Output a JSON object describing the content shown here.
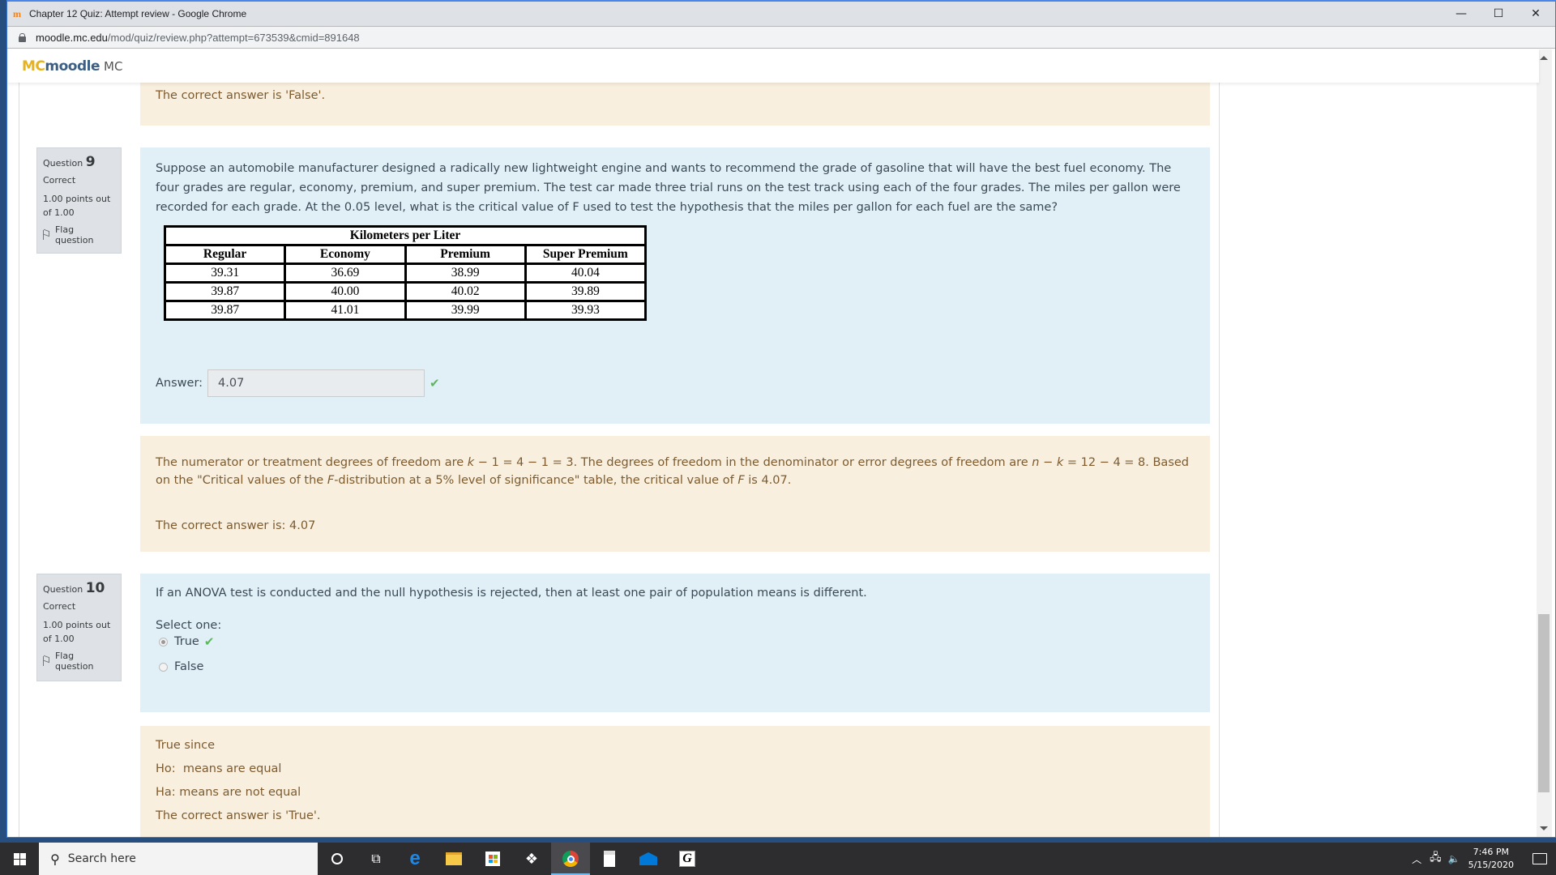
{
  "browser": {
    "window_title": "Chapter 12 Quiz: Attempt review - Google Chrome",
    "url_host": "moodle.mc.edu",
    "url_path": "/mod/quiz/review.php?attempt=673539&cmid=891648",
    "controls": {
      "minimize": "—",
      "maximize": "☐",
      "close": "✕"
    }
  },
  "site": {
    "logo_mc": "MC",
    "logo_moodle": "moodle",
    "site_name": "MC"
  },
  "prev_feedback": {
    "correct_answer": "The correct answer is 'False'."
  },
  "questions": [
    {
      "info": {
        "label": "Question",
        "number": "9",
        "state": "Correct",
        "grade": "1.00 points out of 1.00",
        "flag": "Flag question"
      },
      "text": "Suppose an automobile manufacturer designed a radically new lightweight engine and wants to recommend the grade of gasoline that will have the best fuel economy. The four grades are regular, economy, premium, and super premium. The test car made three trial runs on the test track using each of the four grades. The miles per gallon were recorded for each grade. At the 0.05 level, what is the critical value of F used to test the hypothesis that the miles per gallon for each fuel are the same?",
      "table": {
        "title": "Kilometers per Liter",
        "headers": [
          "Regular",
          "Economy",
          "Premium",
          "Super Premium"
        ],
        "rows": [
          [
            "39.31",
            "36.69",
            "38.99",
            "40.04"
          ],
          [
            "39.87",
            "40.00",
            "40.02",
            "39.89"
          ],
          [
            "39.87",
            "41.01",
            "39.99",
            "39.93"
          ]
        ]
      },
      "answer_label": "Answer:",
      "answer_value": "4.07",
      "feedback": {
        "explanation_parts": {
          "p1": "The numerator or treatment degrees of freedom are ",
          "k1": "k",
          "p2": " − 1 = 4 − 1 = 3. The degrees of freedom in the denominator or error degrees of freedom are ",
          "n": "n",
          "p3": " − ",
          "k2": "k",
          "p4": " = 12 − 4 = 8. Based on the \"Critical values of the ",
          "F1": "F",
          "p5": "-distribution at a 5% level of significance\" table, the critical value of ",
          "F2": "F",
          "p6": " is 4.07."
        },
        "correct_answer": "The correct answer is: 4.07"
      }
    },
    {
      "info": {
        "label": "Question",
        "number": "10",
        "state": "Correct",
        "grade": "1.00 points out of 1.00",
        "flag": "Flag question"
      },
      "text": "If an ANOVA test is conducted and the null hypothesis is rejected, then at least one pair of population means is different.",
      "select_label": "Select one:",
      "options": [
        {
          "label": "True",
          "selected": true,
          "correct": true
        },
        {
          "label": "False",
          "selected": false,
          "correct": false
        }
      ],
      "feedback": {
        "lines": [
          "True since",
          "Ho:  means are equal",
          "Ha: means are not equal"
        ],
        "correct_answer": "The correct answer is 'True'."
      }
    }
  ],
  "taskbar": {
    "search_placeholder": "Search here",
    "apps": [
      "cortana",
      "task-view",
      "edge",
      "file-explorer",
      "store",
      "dropbox",
      "chrome",
      "calculator",
      "mail",
      "g-app"
    ],
    "time": "7:46 PM",
    "date": "5/15/2020"
  },
  "colors": {
    "question_bg": "#e1f0f7",
    "feedback_bg": "#f8efde",
    "feedback_text": "#7d5b2e",
    "correct_check": "#5cb85c",
    "logo_mc": "#e6b21d",
    "logo_moodle": "#3d5f86"
  }
}
